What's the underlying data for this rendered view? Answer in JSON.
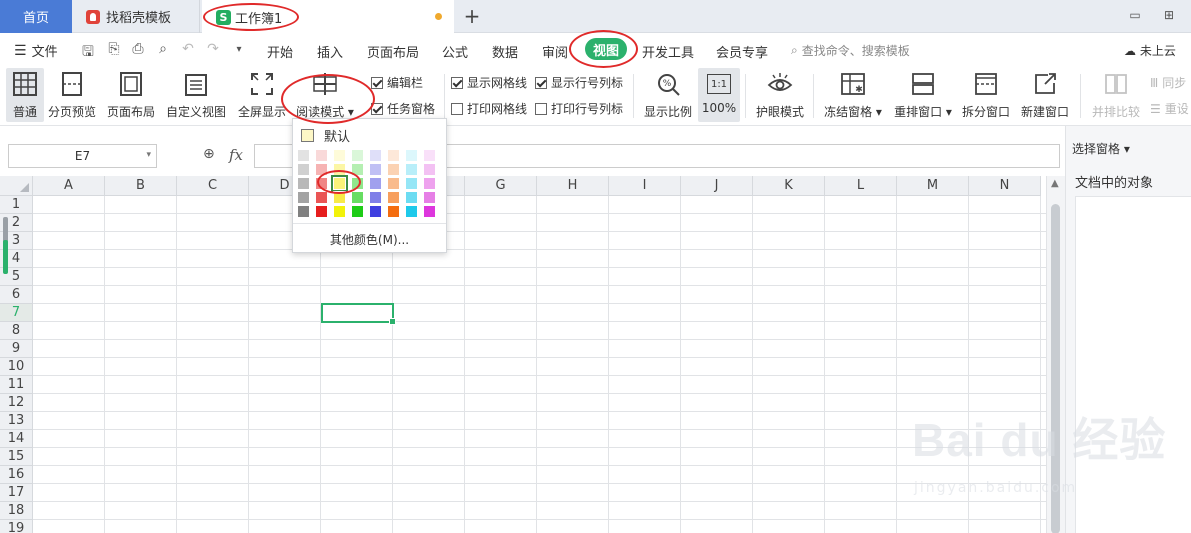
{
  "tabs": {
    "home": "首页",
    "template": "找稻壳模板",
    "doc": "工作簿1",
    "doc_icon_letter": "S",
    "add": "+"
  },
  "menu": {
    "file": "文件",
    "items": [
      "开始",
      "插入",
      "页面布局",
      "公式",
      "数据",
      "审阅",
      "视图",
      "开发工具",
      "会员专享"
    ],
    "active": "视图",
    "search": "查找命令、搜索模板",
    "cloud": "未上云"
  },
  "ribbon": {
    "normal": "普通",
    "page_break": "分页预览",
    "page_layout": "页面布局",
    "custom_view": "自定义视图",
    "full_screen": "全屏显示",
    "reading_mode": "阅读模式",
    "formula_bar": "编辑栏",
    "task_pane": "任务窗格",
    "show_gridlines": "显示网格线",
    "print_gridlines": "打印网格线",
    "show_headers": "显示行号列标",
    "print_headers": "打印行号列标",
    "zoom": "显示比例",
    "zoom_100_icon": "1:1",
    "zoom_100": "100%",
    "eye_mode": "护眼模式",
    "freeze": "冻结窗格",
    "arrange": "重排窗口",
    "split": "拆分窗口",
    "new_window": "新建窗口",
    "side_by_side": "并排比较",
    "sync": "同步",
    "reset": "重设"
  },
  "formula": {
    "name_box": "E7",
    "fx": "fx"
  },
  "grid": {
    "columns": [
      "A",
      "B",
      "C",
      "D",
      "E",
      "F",
      "G",
      "H",
      "I",
      "J",
      "K",
      "L",
      "M",
      "N"
    ],
    "rows": [
      "1",
      "2",
      "3",
      "4",
      "5",
      "6",
      "7",
      "8",
      "9",
      "10",
      "11",
      "12",
      "13",
      "14",
      "15",
      "16",
      "17",
      "18",
      "19"
    ],
    "selected_cell": "E7"
  },
  "dropdown": {
    "default": "默认",
    "more": "其他颜色(M)...",
    "palette_rows": [
      [
        "#e2e2e2",
        "#f9d9d9",
        "#fefbd9",
        "#daf7d9",
        "#dfdff9",
        "#fde8d9",
        "#dcf7fc",
        "#f9e0f9"
      ],
      [
        "#d0d0d0",
        "#f6b3b3",
        "#fcf6a5",
        "#b5efb2",
        "#c0c0f4",
        "#fbd2b3",
        "#b8eef9",
        "#f3c1f3"
      ],
      [
        "#b8b8b8",
        "#f08585",
        "#faf27a",
        "#8fe78b",
        "#a0a0ee",
        "#f9bb8d",
        "#95e6f6",
        "#eea2ee"
      ],
      [
        "#a3a3a3",
        "#ea5555",
        "#f7ea47",
        "#67dd62",
        "#7f7fe8",
        "#f79f5e",
        "#6cdcf2",
        "#e67fe6"
      ],
      [
        "#808080",
        "#e61e1e",
        "#f2f20a",
        "#1ecc16",
        "#3f3fe0",
        "#f46d0f",
        "#1ec9ea",
        "#dd36dd"
      ]
    ]
  },
  "pane": {
    "title": "选择窗格",
    "objects": "文档中的对象"
  },
  "watermark": {
    "brand": "Bai du 经验",
    "url": "jingyan.baidu.com"
  }
}
